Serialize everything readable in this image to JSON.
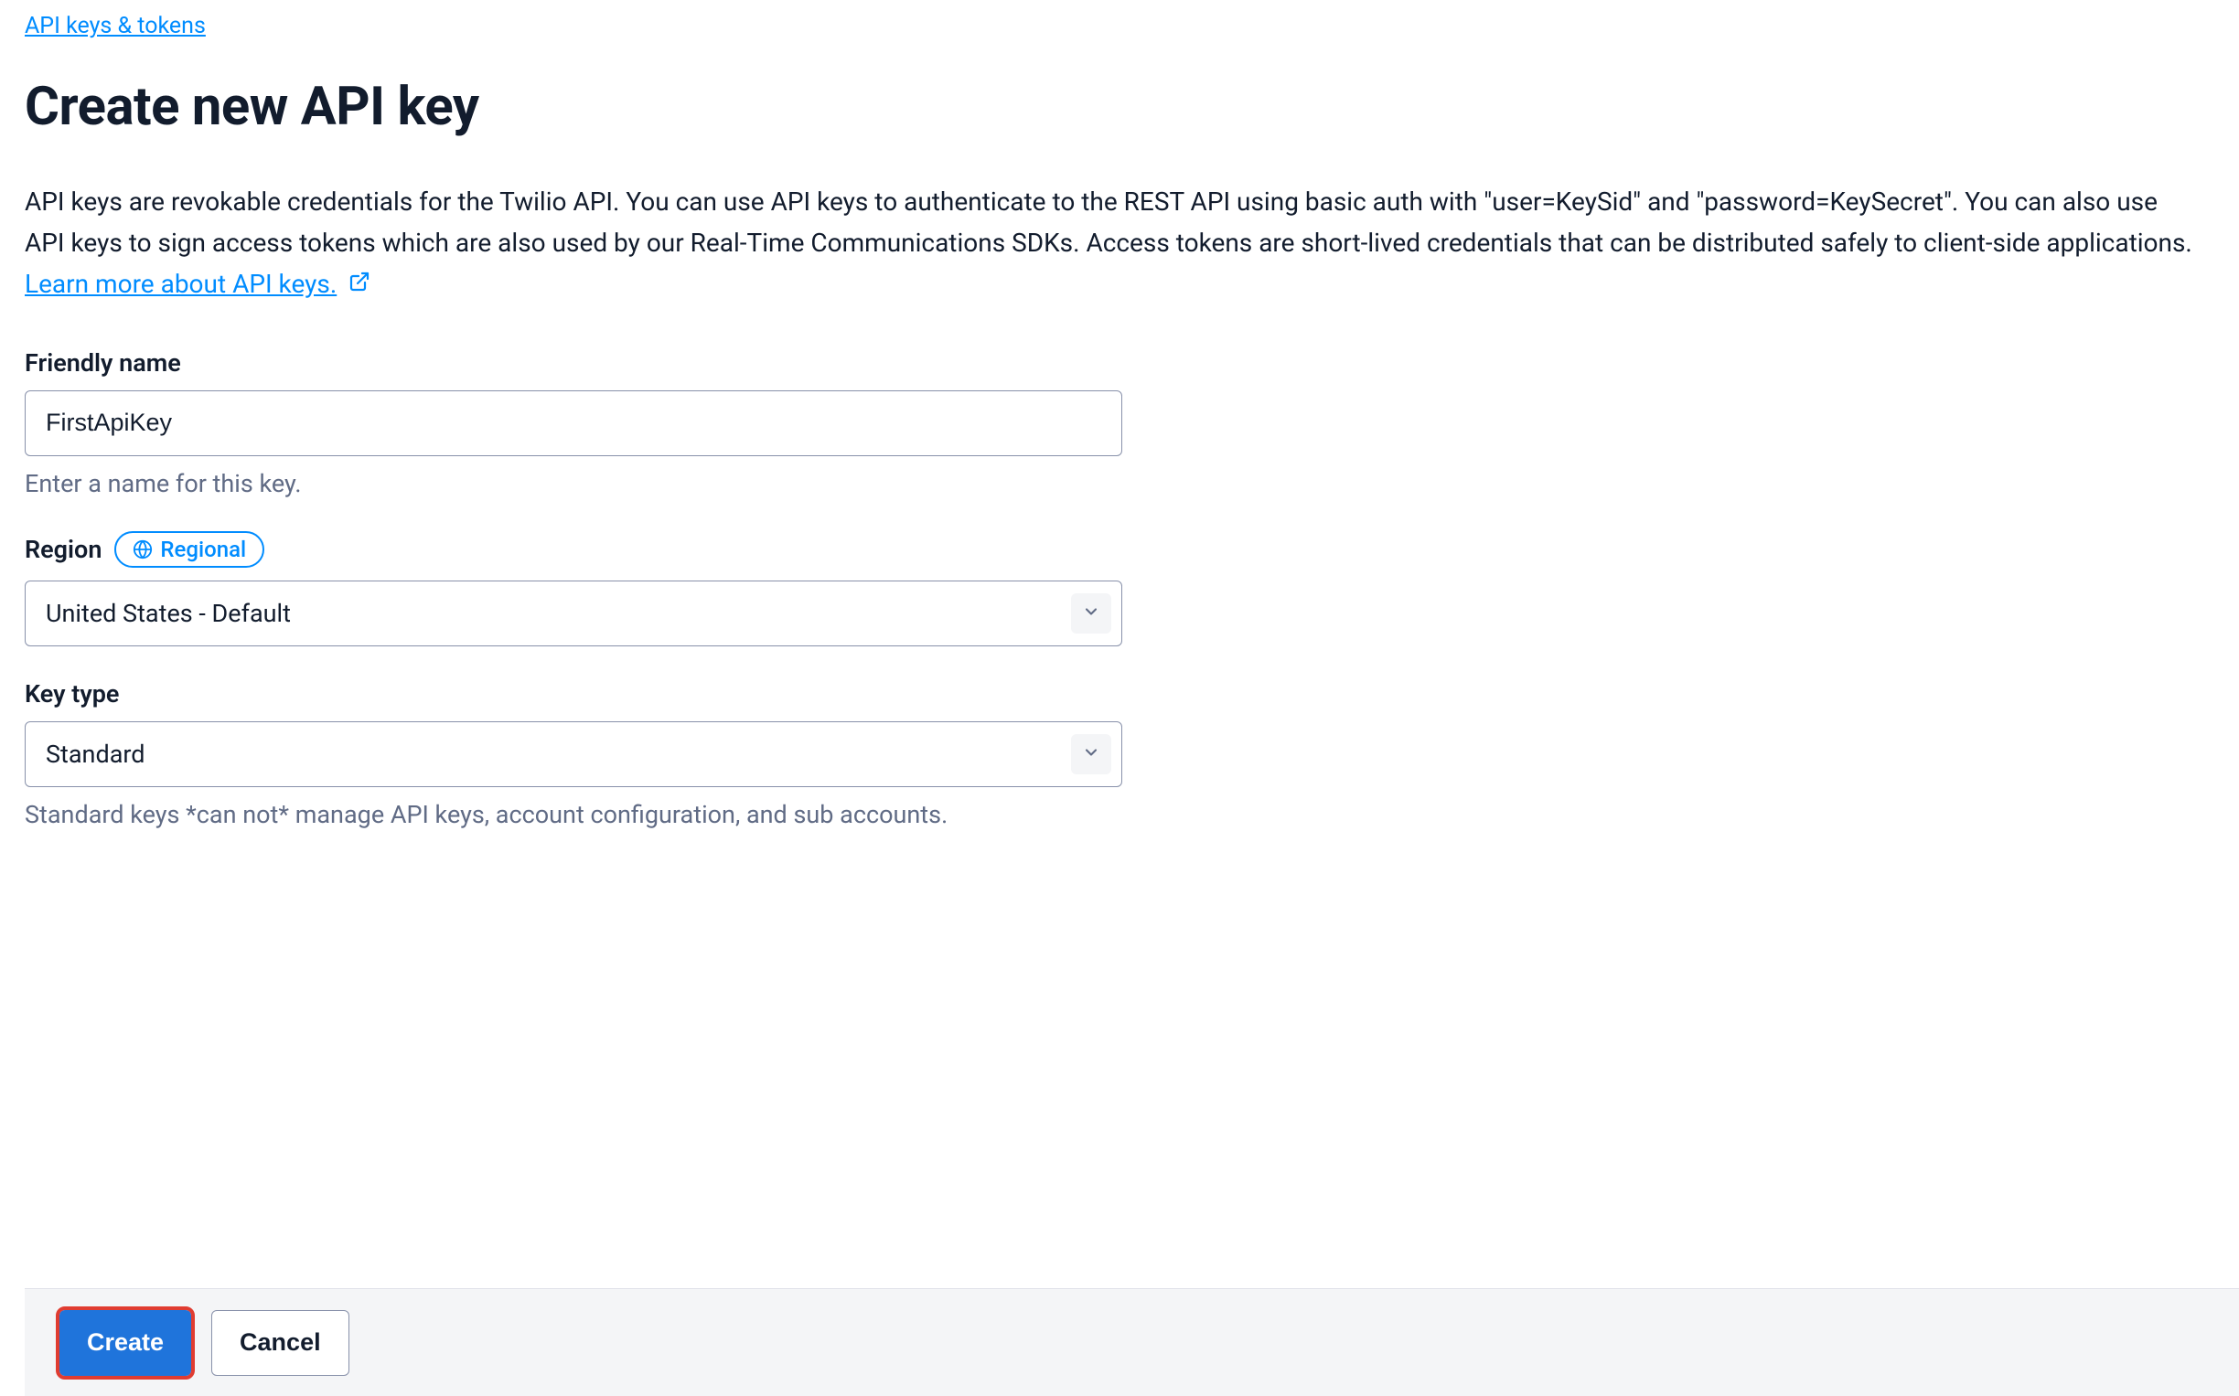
{
  "breadcrumb": {
    "label": "API keys & tokens"
  },
  "page_title": "Create new API key",
  "description": {
    "text": "API keys are revokable credentials for the Twilio API. You can use API keys to authenticate to the REST API using basic auth with \"user=KeySid\" and \"password=KeySecret\". You can also use API keys to sign access tokens which are also used by our Real-Time Communications SDKs. Access tokens are short-lived credentials that can be distributed safely to client-side applications. ",
    "learn_link": "Learn more about API keys."
  },
  "form": {
    "friendly_name": {
      "label": "Friendly name",
      "value": "FirstApiKey",
      "help": "Enter a name for this key."
    },
    "region": {
      "label": "Region",
      "pill_label": "Regional",
      "value": "United States - Default"
    },
    "key_type": {
      "label": "Key type",
      "value": "Standard",
      "help": "Standard keys *can not* manage API keys, account configuration, and sub accounts."
    }
  },
  "footer": {
    "create_label": "Create",
    "cancel_label": "Cancel"
  }
}
